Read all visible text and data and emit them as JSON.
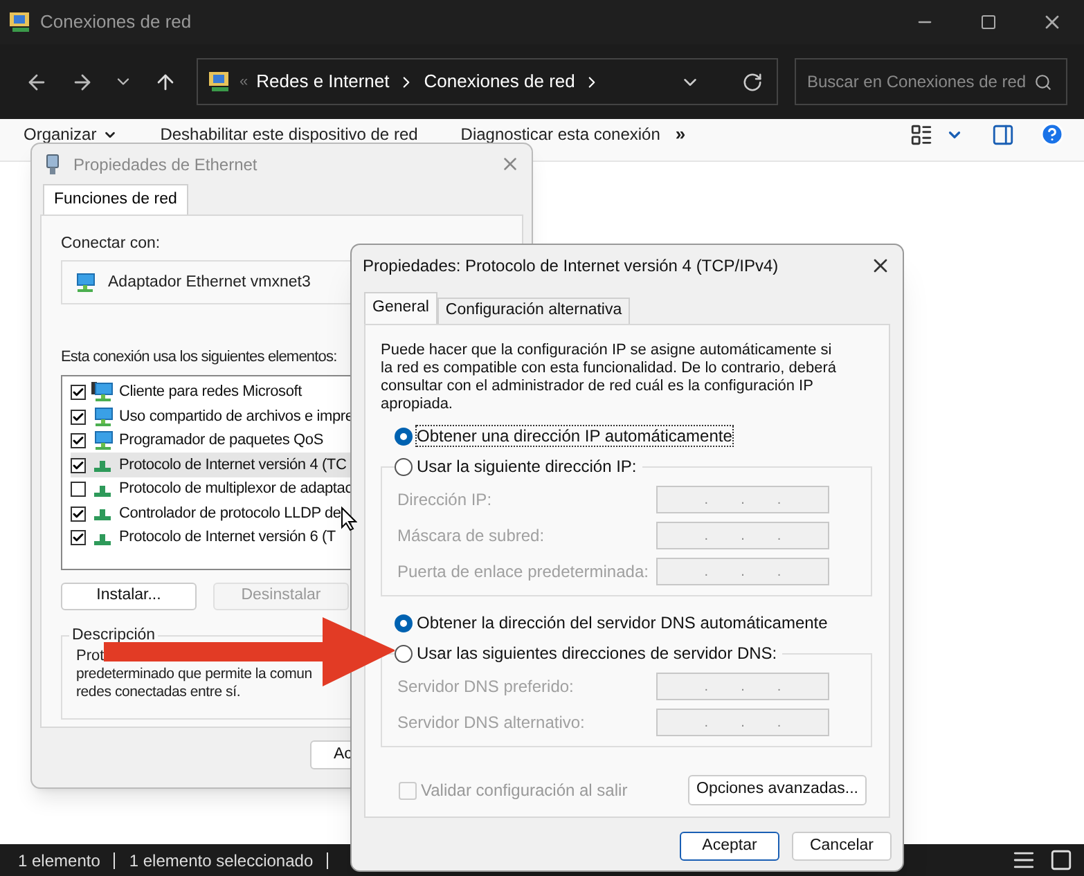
{
  "explorer": {
    "title": "Conexiones de red",
    "breadcrumb_overflow": "«",
    "breadcrumb": [
      "Redes e Internet",
      "Conexiones de red"
    ],
    "search": {
      "placeholder": "Buscar en Conexiones de red"
    },
    "toolbar": [
      {
        "label": "Organizar",
        "kind": "menu"
      },
      {
        "label": "Deshabilitar este dispositivo de red",
        "kind": "plain"
      },
      {
        "label": "Diagnosticar esta conexión",
        "kind": "plain"
      }
    ],
    "overflow": "»",
    "status_bar": [
      "1 elemento",
      "1 elemento seleccionado"
    ]
  },
  "ethernet_dialog": {
    "title": "Propiedades de Ethernet",
    "tabs": [
      {
        "label": "Funciones de red",
        "selected": true
      }
    ],
    "connect_label": "Conectar con:",
    "adapter": "Adaptador Ethernet vmxnet3",
    "items_label": "Esta conexión usa los siguientes elementos:",
    "items": [
      {
        "label": "Cliente para redes Microsoft",
        "checked": true,
        "selected": false,
        "kind": "client"
      },
      {
        "label": "Uso compartido de archivos e impre",
        "checked": true,
        "selected": false,
        "kind": "service"
      },
      {
        "label": "Programador de paquetes QoS",
        "checked": true,
        "selected": false,
        "kind": "service"
      },
      {
        "label": "Protocolo de Internet versión 4 (TC",
        "checked": true,
        "selected": true,
        "kind": "protocol"
      },
      {
        "label": "Protocolo de multiplexor de adaptac",
        "checked": false,
        "selected": false,
        "kind": "protocol"
      },
      {
        "label": "Controlador de protocolo LLDP de",
        "checked": true,
        "selected": false,
        "kind": "protocol"
      },
      {
        "label": "Protocolo de Internet versión 6 (T",
        "checked": true,
        "selected": false,
        "kind": "protocol"
      }
    ],
    "buttons": [
      {
        "label": "Instalar...",
        "disabled": false
      },
      {
        "label": "Desinstalar",
        "disabled": true
      }
    ],
    "description": {
      "title": "Descripción",
      "fragments": [
        "Prot",
        "predeterminado que permite la comun\nredes conectadas entre sí."
      ]
    },
    "ok_button": "Ac"
  },
  "ipv4_dialog": {
    "title": "Propiedades: Protocolo de Internet versión 4 (TCP/IPv4)",
    "tabs": [
      {
        "label": "General",
        "selected": true
      },
      {
        "label": "Configuración alternativa",
        "selected": false
      }
    ],
    "intro": "Puede hacer que la configuración IP se asigne automáticamente si la red es compatible con esta funcionalidad. De lo contrario, deberá consultar con el administrador de red cuál es la configuración IP apropiada.",
    "ip_mode": [
      {
        "label": "Obtener una dirección IP automáticamente",
        "selected": true,
        "focused": true
      },
      {
        "label": "Usar la siguiente dirección IP:",
        "selected": false,
        "focused": false
      }
    ],
    "ip_fields": [
      {
        "label": "Dirección IP:",
        "disabled": true,
        "dots": [
          ".",
          ".",
          "."
        ]
      },
      {
        "label": "Máscara de subred:",
        "disabled": true,
        "dots": [
          ".",
          ".",
          "."
        ]
      },
      {
        "label": "Puerta de enlace predeterminada:",
        "disabled": true,
        "dots": [
          ".",
          ".",
          "."
        ]
      }
    ],
    "dns_mode": [
      {
        "label": "Obtener la dirección del servidor DNS automáticamente",
        "selected": true,
        "focused": false
      },
      {
        "label": "Usar las siguientes direcciones de servidor DNS:",
        "selected": false,
        "focused": false
      }
    ],
    "dns_fields": [
      {
        "label": "Servidor DNS preferido:",
        "disabled": true,
        "dots": [
          ".",
          ".",
          "."
        ]
      },
      {
        "label": "Servidor DNS alternativo:",
        "disabled": true,
        "dots": [
          ".",
          ".",
          "."
        ]
      }
    ],
    "validate": {
      "label": "Validar configuración al salir",
      "checked": false,
      "disabled": true
    },
    "advanced_button": "Opciones avanzadas...",
    "buttons": [
      "Aceptar",
      "Cancelar"
    ]
  }
}
